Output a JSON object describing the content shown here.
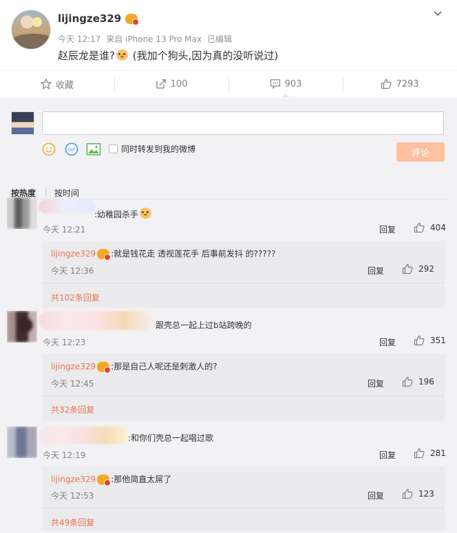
{
  "post": {
    "username": "lijingze329",
    "time": "今天 12:17",
    "source": "来自 iPhone 13 Pro Max",
    "edited": "已编辑",
    "text_before": "赵辰龙是谁?",
    "text_after": " (我加个狗头,因为真的没听说过)"
  },
  "actions": {
    "favorite": "收藏",
    "repost_count": "100",
    "comment_count": "903",
    "like_count": "7293"
  },
  "composer": {
    "placeholder": "",
    "repost_label": "同时转发到我的微博",
    "submit_label": "评论"
  },
  "sort": {
    "hot": "按热度",
    "separator": "|",
    "time": "按时间"
  },
  "comments": [
    {
      "text": ":幼稚园杀手",
      "time": "今天 12:21",
      "reply": "回复",
      "likes": "404",
      "sub": {
        "user": "lijingze329",
        "text": ":就是钱花走 透视莲花手 后事前发抖 的?????",
        "time": "今天 12:36",
        "reply": "回复",
        "likes": "292"
      },
      "more": "共102条回复"
    },
    {
      "text": "跟壳总一起上过b站跨晚的",
      "time": "今天 12:23",
      "reply": "回复",
      "likes": "351",
      "sub": {
        "user": "lijingze329",
        "text": ":那是自己人呢还是刺激人的?",
        "time": "今天 12:45",
        "reply": "回复",
        "likes": "196"
      },
      "more": "共32条回复"
    },
    {
      "text": ":和你们壳总一起唱过歌",
      "time": "今天 12:19",
      "reply": "回复",
      "likes": "281",
      "sub": {
        "user": "lijingze329",
        "text": ":那他简直太屌了",
        "time": "今天 12:53",
        "reply": "回复",
        "likes": "123"
      },
      "more": "共49条回复"
    }
  ]
}
